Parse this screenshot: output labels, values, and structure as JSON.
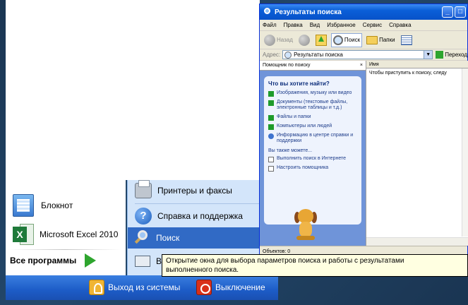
{
  "start_menu": {
    "pinned": [
      {
        "label": "Блокнот",
        "icon": "notepad-icon"
      },
      {
        "label": "Microsoft Excel 2010",
        "icon": "excel-icon"
      }
    ],
    "all_programs_label": "Все программы",
    "right_items": {
      "printers": "Принтеры и факсы",
      "help": "Справка и поддержка",
      "search": "Поиск",
      "run_partial": "В"
    },
    "logoff_label": "Выход из системы",
    "shutdown_label": "Выключение"
  },
  "search_window": {
    "title": "Результаты поиска",
    "menu": [
      "Файл",
      "Правка",
      "Вид",
      "Избранное",
      "Сервис",
      "Справка"
    ],
    "toolbar": {
      "back": "Назад",
      "search": "Поиск",
      "folders": "Папки"
    },
    "address_label": "Адрес:",
    "address_value": "Результаты поиска",
    "go_label": "Переход",
    "pane": {
      "header": "Помощник по поиску",
      "close": "×",
      "question": "Что вы хотите найти?",
      "options": [
        "Изображения, музыку или видео",
        "Документы (текстовые файлы, электронные таблицы и т.д.)",
        "Файлы и папки",
        "Компьютеры или людей",
        "Информацию в центре справки и поддержки"
      ],
      "also_label": "Вы также можете...",
      "also_options": [
        "Выполнить поиск в Интернете",
        "Настроить помощника"
      ]
    },
    "results": {
      "column_name": "Имя",
      "message": "Чтобы приступить к поиску, следу"
    },
    "status": "Объектов: 0"
  },
  "tooltip": {
    "text_line1": "Открытие окна для выбора параметров поиска и работы с результатами",
    "text_line2": "выполненного поиска."
  },
  "colors": {
    "start_blue": "#1d5cc7",
    "highlight": "#316ac5",
    "pane_blue": "#6f94d9",
    "tooltip_bg": "#ffffe1"
  }
}
